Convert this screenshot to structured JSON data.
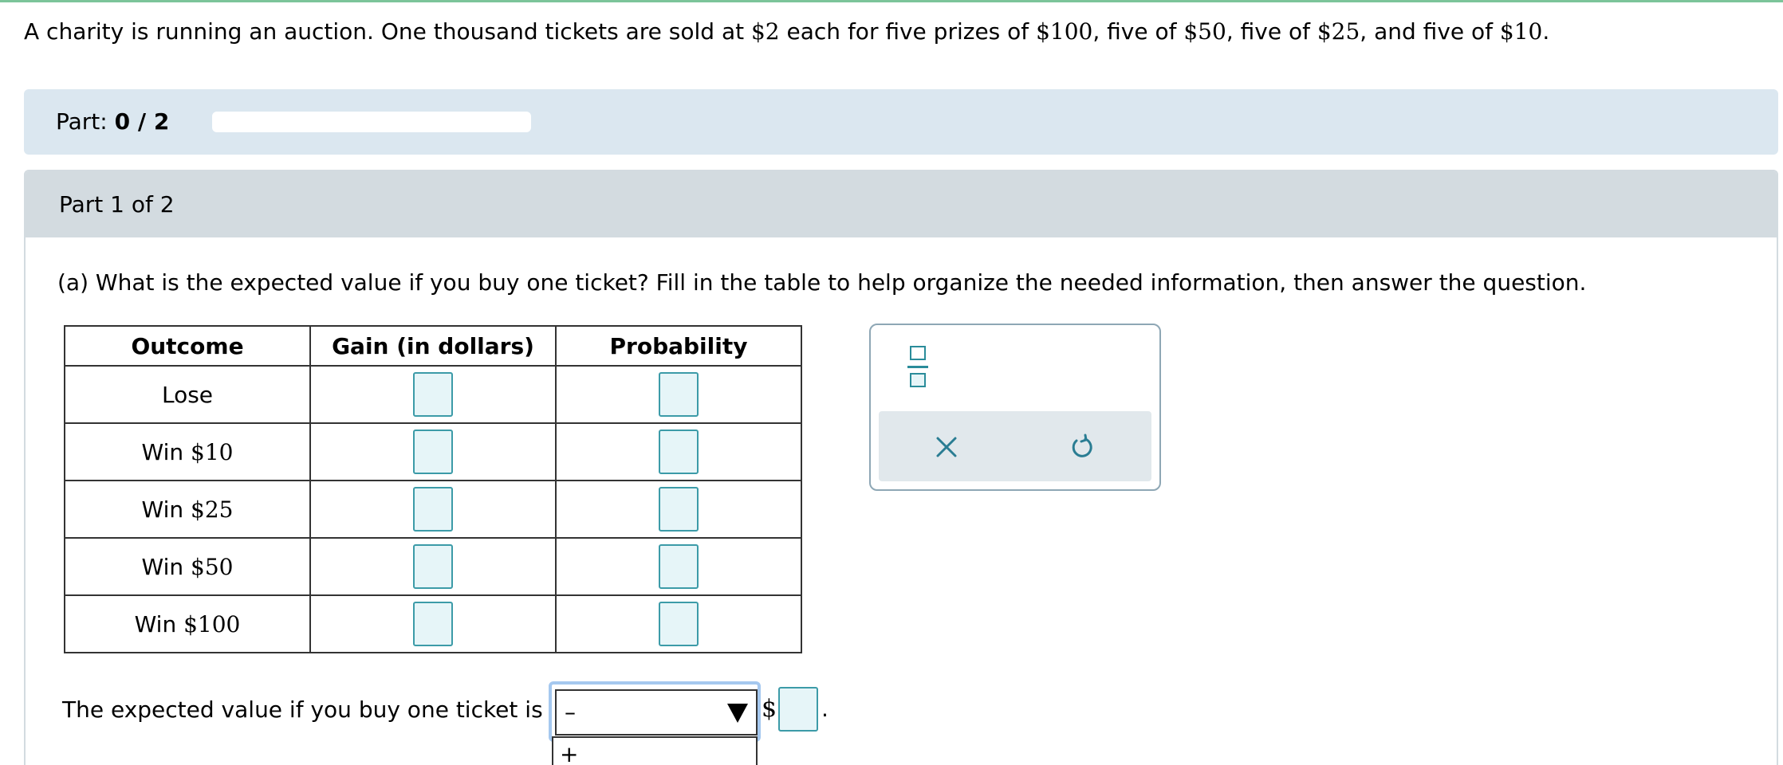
{
  "problem": {
    "text_a": "A charity is running an auction. One thousand tickets are sold at ",
    "price": "$2",
    "text_b": " each for five prizes of ",
    "p1": "$100",
    "text_c": ", five of ",
    "p2": "$50",
    "text_d": ", five of ",
    "p3": "$25",
    "text_e": ", and five of ",
    "p4": "$10",
    "text_f": "."
  },
  "part_bar": {
    "label": "Part:",
    "current": "0 / 2",
    "progress": 0
  },
  "card": {
    "header": "Part 1 of 2",
    "question": "(a) What is the expected value if you buy one ticket? Fill in the table to help organize the needed information, then answer the question."
  },
  "table": {
    "headers": [
      "Outcome",
      "Gain (in dollars)",
      "Probability"
    ],
    "rows": [
      {
        "prefix": "Lose",
        "amount": ""
      },
      {
        "prefix": "Win ",
        "amount": "$10"
      },
      {
        "prefix": "Win ",
        "amount": "$25"
      },
      {
        "prefix": "Win ",
        "amount": "$50"
      },
      {
        "prefix": "Win ",
        "amount": "$100"
      }
    ]
  },
  "tool": {
    "fraction_icon": "fraction-icon",
    "clear_icon": "close-icon",
    "undo_icon": "undo-icon"
  },
  "answer": {
    "text": "The expected value if you buy one ticket is",
    "selected": "–",
    "option": "+",
    "currency": "$",
    "period": "."
  },
  "colors": {
    "accent": "#3c9ba8",
    "part_bar": "#dbe7f0",
    "card_header": "#d3dbe0",
    "focus": "#a5c8ef"
  }
}
